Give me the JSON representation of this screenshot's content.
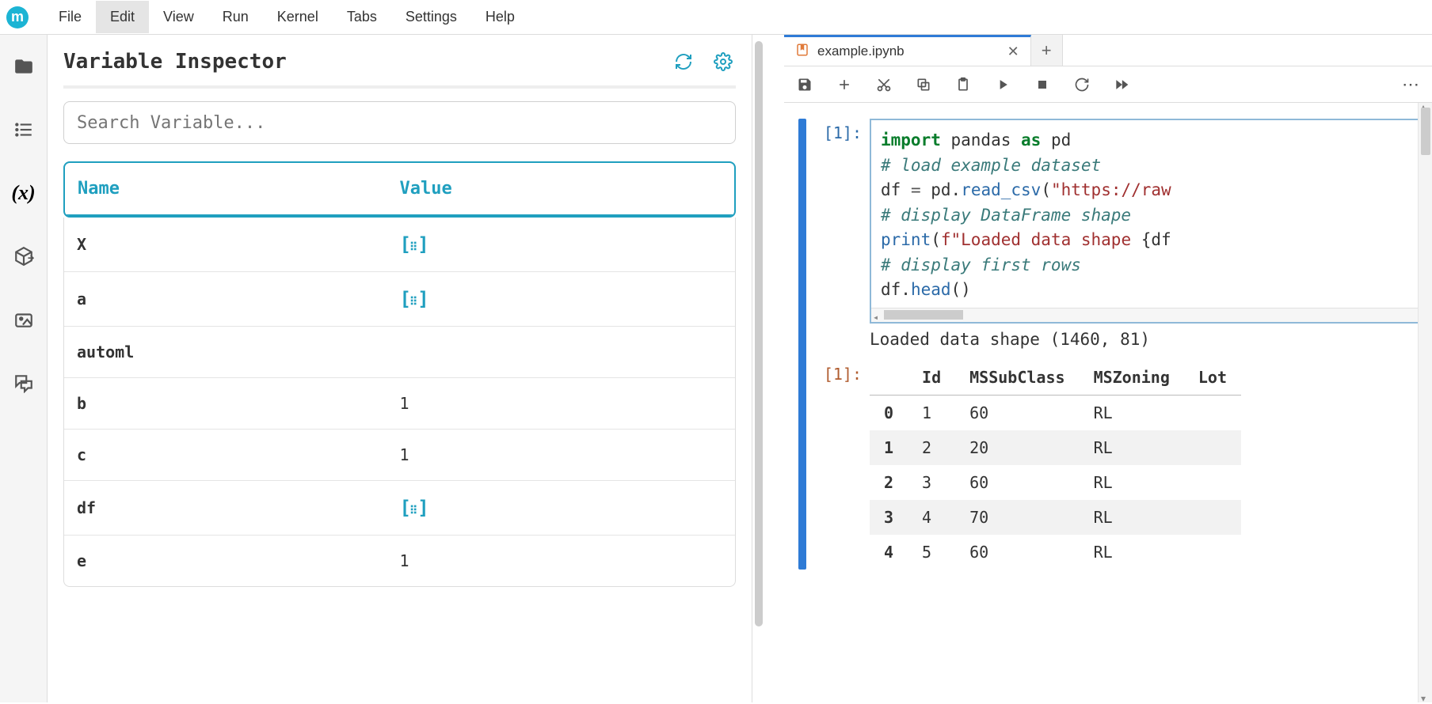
{
  "menus": [
    "File",
    "Edit",
    "View",
    "Run",
    "Kernel",
    "Tabs",
    "Settings",
    "Help"
  ],
  "menus_open_index": 1,
  "inspector": {
    "title": "Variable Inspector",
    "search_placeholder": "Search Variable...",
    "columns": {
      "name": "Name",
      "value": "Value"
    },
    "rows": [
      {
        "name": "X",
        "value_type": "dataframe"
      },
      {
        "name": "a",
        "value_type": "dataframe"
      },
      {
        "name": "automl",
        "value_type": "empty"
      },
      {
        "name": "b",
        "value_type": "scalar",
        "value": "1"
      },
      {
        "name": "c",
        "value_type": "scalar",
        "value": "1"
      },
      {
        "name": "df",
        "value_type": "dataframe"
      },
      {
        "name": "e",
        "value_type": "scalar",
        "value": "1"
      }
    ]
  },
  "notebook": {
    "tab_title": "example.ipynb",
    "cell_in_prompt": "[1]:",
    "cell_out_prompt": "[1]:",
    "code_lines": [
      {
        "html": "<span class='kw'>import</span> pandas <span class='kw'>as</span> pd"
      },
      {
        "html": "<span class='cm'># load example dataset</span>"
      },
      {
        "html": "df <span class='op'>=</span> pd.<span class='fn'>read_csv</span>(<span class='st'>\"https://raw</span>"
      },
      {
        "html": "<span class='cm'># display DataFrame shape</span>"
      },
      {
        "html": "<span class='fn'>print</span>(<span class='st'>f\"Loaded data shape </span>{df"
      },
      {
        "html": "<span class='cm'># display first rows</span>"
      },
      {
        "html": "df.<span class='fn'>head</span>()"
      }
    ],
    "output_text": "Loaded data shape (1460, 81)",
    "df_head": {
      "columns": [
        "Id",
        "MSSubClass",
        "MSZoning",
        "Lot"
      ],
      "rows": [
        {
          "idx": "0",
          "cells": [
            "1",
            "60",
            "RL",
            ""
          ]
        },
        {
          "idx": "1",
          "cells": [
            "2",
            "20",
            "RL",
            ""
          ]
        },
        {
          "idx": "2",
          "cells": [
            "3",
            "60",
            "RL",
            ""
          ]
        },
        {
          "idx": "3",
          "cells": [
            "4",
            "70",
            "RL",
            ""
          ]
        },
        {
          "idx": "4",
          "cells": [
            "5",
            "60",
            "RL",
            ""
          ]
        }
      ]
    }
  }
}
